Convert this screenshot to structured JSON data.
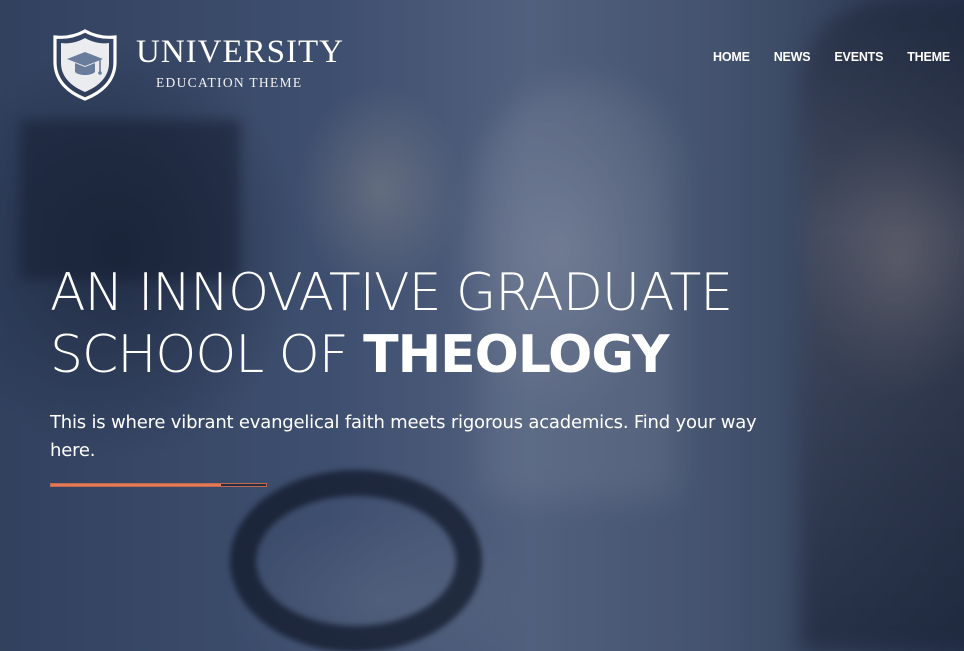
{
  "brand": {
    "title": "UNIVERSITY",
    "subtitle": "EDUCATION THEME",
    "icon": "graduation-cap-shield-icon"
  },
  "nav": {
    "items": [
      {
        "label": "HOME"
      },
      {
        "label": "NEWS"
      },
      {
        "label": "EVENTS"
      },
      {
        "label": "THEME"
      }
    ]
  },
  "hero": {
    "headline_line1": "AN INNOVATIVE GRADUATE",
    "headline_line2_light": "SCHOOL OF ",
    "headline_line2_bold": "THEOLOGY",
    "subtext": "This is where vibrant evangelical faith meets rigorous academics. Find your way here.",
    "slider_progress": 0.79
  },
  "colors": {
    "accent": "#e57a57",
    "overlay": "#22304e",
    "text": "#ffffff"
  }
}
